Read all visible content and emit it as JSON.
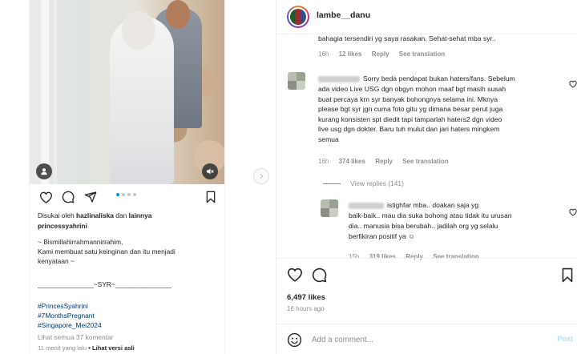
{
  "left_post": {
    "image_alt": "",
    "caption": {
      "liked_by_prefix": "Disukai oleh",
      "liked_by_user": "hazlinaliska",
      "liked_by_and": "dan",
      "liked_by_others": "lainnya",
      "author": "princessyahrini",
      "line1": "~ Bismillahirrahmannirrahim,",
      "line2": "Kami membuat satu keinginan dan itu menjadi",
      "line3": "kenyataan ~",
      "signature": "_______________~SYR~_______________",
      "hashtags": [
        "#PrincesSyahrini",
        "#7MonthsPregnant",
        "#Singapore_Mei2024"
      ],
      "view_comments": "Lihat semua 37 komentar",
      "time": "11 menit yang lalu",
      "see_original": "• Lihat versi asli"
    },
    "carousel_dots": 4,
    "active_dot": 0
  },
  "right_panel": {
    "username": "lambe__danu",
    "comments": [
      {
        "text_lines": [
          "bahagia tersendiri yg saya rasakan. Sehat-sehat mba syr.."
        ],
        "time": "16h",
        "likes": "12 likes",
        "reply": "Reply",
        "translate": "See translation"
      },
      {
        "text_lines": [
          "Sorry beda pendapat bukan haters/fans. Sebelum",
          "ada video Live USG dgn obgyn mohon maaf bgt masih susah",
          "buat percaya krn syr banyak bohongnya selama ini. Mknya",
          "please bgt syr jgn cuma foto gitu yg dimana besar perut juga",
          "kurang konsisten spt diedit tapi tamparlah haters2 dgn video",
          "live usg dgn dokter. Baru tuh mulut dan jari haters mingkem",
          "semua"
        ],
        "time": "16h",
        "likes": "374 likes",
        "reply": "Reply",
        "translate": "See translation"
      }
    ],
    "view_replies": "View replies (141)",
    "reply_comment": {
      "text_lines": [
        "istighfar mba.. doakan saja yg",
        "baik-baik.. mau dia suka bohong atau tidak itu urusan",
        "dia.. manusia bisa berubah.. jadilah org yg selalu",
        "berfikiran positif ya ☺"
      ],
      "time": "15h",
      "likes": "319 likes",
      "reply": "Reply",
      "translate": "See translation"
    },
    "likes_count": "6,497 likes",
    "posted_ago": "16 hours ago",
    "add_comment_placeholder": "Add a comment...",
    "post_label": "Post"
  },
  "colors": {
    "text": "#262626",
    "muted": "#8e8e8e",
    "link": "#00376b",
    "accent": "#0095f6"
  }
}
